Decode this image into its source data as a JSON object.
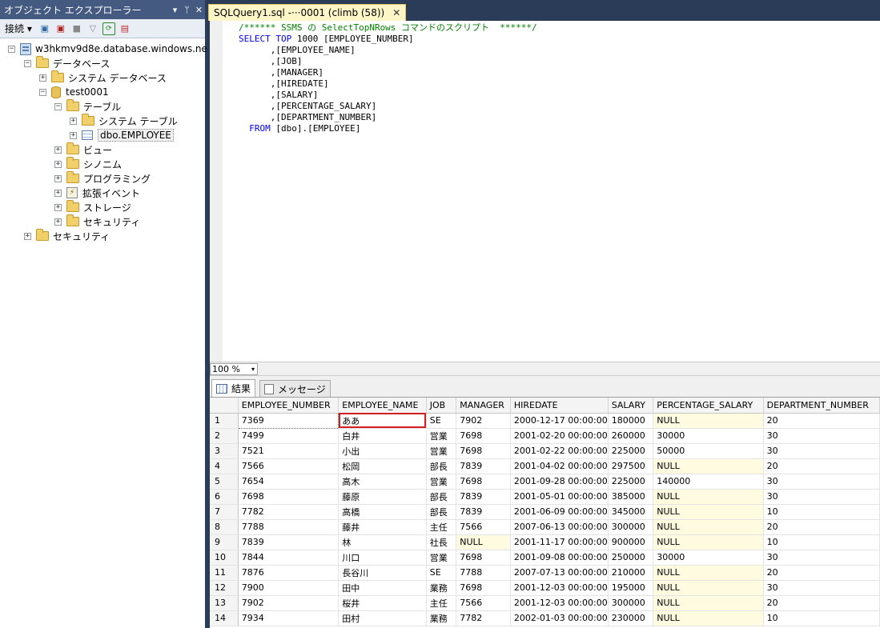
{
  "object_explorer": {
    "title": "オブジェクト エクスプローラー",
    "controls": [
      "▾",
      "ᛘ",
      "✕"
    ],
    "toolbar": {
      "connect_label": "接続 ▾"
    },
    "tree": [
      {
        "label": "w3hkmv9d8e.database.windows.ne",
        "expander": "−",
        "icon": "server"
      },
      {
        "label": "データベース",
        "expander": "−",
        "icon": "folder"
      },
      {
        "label": "システム データベース",
        "expander": "+",
        "icon": "folder"
      },
      {
        "label": "test0001",
        "expander": "−",
        "icon": "database"
      },
      {
        "label": "テーブル",
        "expander": "−",
        "icon": "folder"
      },
      {
        "label": "システム テーブル",
        "expander": "+",
        "icon": "folder"
      },
      {
        "label": "dbo.EMPLOYEE",
        "expander": "+",
        "icon": "table"
      },
      {
        "label": "ビュー",
        "expander": "+",
        "icon": "folder"
      },
      {
        "label": "シノニム",
        "expander": "+",
        "icon": "folder"
      },
      {
        "label": "プログラミング",
        "expander": "+",
        "icon": "folder"
      },
      {
        "label": "拡張イベント",
        "expander": "+",
        "icon": "event"
      },
      {
        "label": "ストレージ",
        "expander": "+",
        "icon": "folder"
      },
      {
        "label": "セキュリティ",
        "expander": "+",
        "icon": "folder"
      },
      {
        "label": "セキュリティ",
        "expander": "+",
        "icon": "folder"
      }
    ]
  },
  "document_tab": {
    "title": "SQLQuery1.sql -···0001 (climb (58))",
    "close": "✕"
  },
  "editor": {
    "comment": "/****** SSMS の SelectTopNRows コマンドのスクリプト  ******/",
    "select_kw": "SELECT",
    "top_kw": "TOP",
    "top_value": " 1000 [EMPLOYEE_NUMBER]",
    "columns": [
      ",[EMPLOYEE_NAME]",
      ",[JOB]",
      ",[MANAGER]",
      ",[HIREDATE]",
      ",[SALARY]",
      ",[PERCENTAGE_SALARY]",
      ",[DEPARTMENT_NUMBER]"
    ],
    "from_kw": "FROM",
    "from_target": " [dbo].[EMPLOYEE]"
  },
  "zoom": {
    "value": "100 %",
    "arrow": "▾"
  },
  "results_tabs": {
    "results": "結果",
    "messages": "メッセージ"
  },
  "grid": {
    "columns": [
      "EMPLOYEE_NUMBER",
      "EMPLOYEE_NAME",
      "JOB",
      "MANAGER",
      "HIREDATE",
      "SALARY",
      "PERCENTAGE_SALARY",
      "DEPARTMENT_NUMBER"
    ],
    "rows": [
      [
        "1",
        "7369",
        "ああ",
        "SE",
        "7902",
        "2000-12-17 00:00:00",
        "180000",
        "NULL",
        "20"
      ],
      [
        "2",
        "7499",
        "白井",
        "営業",
        "7698",
        "2001-02-20 00:00:00",
        "260000",
        "30000",
        "30"
      ],
      [
        "3",
        "7521",
        "小出",
        "営業",
        "7698",
        "2001-02-22 00:00:00",
        "225000",
        "50000",
        "30"
      ],
      [
        "4",
        "7566",
        "松岡",
        "部長",
        "7839",
        "2001-04-02 00:00:00",
        "297500",
        "NULL",
        "20"
      ],
      [
        "5",
        "7654",
        "高木",
        "営業",
        "7698",
        "2001-09-28 00:00:00",
        "225000",
        "140000",
        "30"
      ],
      [
        "6",
        "7698",
        "藤原",
        "部長",
        "7839",
        "2001-05-01 00:00:00",
        "385000",
        "NULL",
        "30"
      ],
      [
        "7",
        "7782",
        "高橋",
        "部長",
        "7839",
        "2001-06-09 00:00:00",
        "345000",
        "NULL",
        "10"
      ],
      [
        "8",
        "7788",
        "藤井",
        "主任",
        "7566",
        "2007-06-13 00:00:00",
        "300000",
        "NULL",
        "20"
      ],
      [
        "9",
        "7839",
        "林",
        "社長",
        "NULL",
        "2001-11-17 00:00:00",
        "900000",
        "NULL",
        "10"
      ],
      [
        "10",
        "7844",
        "川口",
        "営業",
        "7698",
        "2001-09-08 00:00:00",
        "250000",
        "30000",
        "30"
      ],
      [
        "11",
        "7876",
        "長谷川",
        "SE",
        "7788",
        "2007-07-13 00:00:00",
        "210000",
        "NULL",
        "20"
      ],
      [
        "12",
        "7900",
        "田中",
        "業務",
        "7698",
        "2001-12-03 00:00:00",
        "195000",
        "NULL",
        "30"
      ],
      [
        "13",
        "7902",
        "桜井",
        "主任",
        "7566",
        "2001-12-03 00:00:00",
        "300000",
        "NULL",
        "20"
      ],
      [
        "14",
        "7934",
        "田村",
        "業務",
        "7782",
        "2002-01-03 00:00:00",
        "230000",
        "NULL",
        "10"
      ]
    ]
  }
}
